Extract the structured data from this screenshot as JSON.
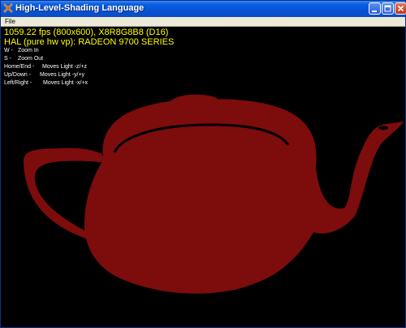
{
  "window": {
    "title": "High-Level-Shading Language",
    "menu": [
      "File"
    ]
  },
  "hud": {
    "fps_line": "1059.22 fps (800x600), X8R8G8B8 (D16)",
    "device_line": "HAL (pure hw vp): RADEON 9700 SERIES"
  },
  "help": [
    {
      "key": "W -",
      "action": "Zoom In"
    },
    {
      "key": "S -",
      "action": "Zoom Out"
    },
    {
      "key": "Home/End -",
      "action": "Moves Light -z/+z"
    },
    {
      "key": "Up/Down -",
      "action": "Moves Light -y/+y"
    },
    {
      "key": "Left/Right -",
      "action": "Moves Light -x/+x"
    }
  ],
  "scene": {
    "background_color": "#000000",
    "teapot_color": "#7d0c0c",
    "hud_stat_color": "#ffff00",
    "hud_help_color": "#ffffff"
  }
}
